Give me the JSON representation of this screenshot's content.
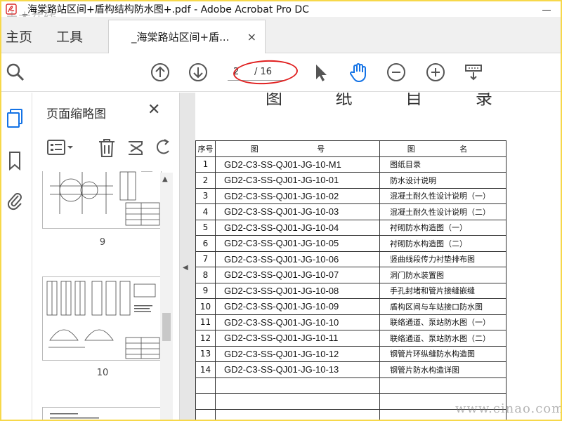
{
  "window": {
    "title": "_海棠路站区间+盾构结构防水图+.pdf - Adobe Acrobat Pro DC"
  },
  "tabs": {
    "home": "主页",
    "tools": "工具",
    "document": "_海棠路站区间+盾...",
    "close_glyph": "×"
  },
  "toolbar": {
    "icons": [
      "zoom-search-icon",
      "page-up-icon",
      "page-down-icon",
      "select-arrow-icon",
      "hand-tool-icon",
      "zoom-out-icon",
      "zoom-in-icon",
      "scroll-mode-icon"
    ],
    "page_current": "2",
    "page_total": "/ 16",
    "hand_color": "#1473e6"
  },
  "sidebar": {
    "icons": [
      "page-thumbnails-icon",
      "bookmark-icon",
      "attachment-icon"
    ],
    "active_color": "#1473e6"
  },
  "thumb_panel": {
    "title": "页面缩略图",
    "close_glyph": "✕",
    "tools": [
      "options-icon",
      "delete-icon",
      "crop-icon",
      "rotate-icon"
    ],
    "pages": [
      {
        "label": "9"
      },
      {
        "label": "10"
      }
    ]
  },
  "document": {
    "heading": "图 纸 目 录",
    "table": {
      "headers": [
        "序号",
        "图 号",
        "图 名"
      ],
      "rows": [
        [
          "1",
          "GD2-C3-SS-QJ01-JG-10-M1",
          "图纸目录"
        ],
        [
          "2",
          "GD2-C3-SS-QJ01-JG-10-01",
          "防水设计说明"
        ],
        [
          "3",
          "GD2-C3-SS-QJ01-JG-10-02",
          "混凝土耐久性设计说明（一）"
        ],
        [
          "4",
          "GD2-C3-SS-QJ01-JG-10-03",
          "混凝土耐久性设计说明（二）"
        ],
        [
          "5",
          "GD2-C3-SS-QJ01-JG-10-04",
          "衬砌防水构造图（一）"
        ],
        [
          "6",
          "GD2-C3-SS-QJ01-JG-10-05",
          "衬砌防水构造图（二）"
        ],
        [
          "7",
          "GD2-C3-SS-QJ01-JG-10-06",
          "竖曲线段传力衬垫排布图"
        ],
        [
          "8",
          "GD2-C3-SS-QJ01-JG-10-07",
          "洞门防水装置图"
        ],
        [
          "9",
          "GD2-C3-SS-QJ01-JG-10-08",
          "手孔封堵和管片接缝嵌缝"
        ],
        [
          "10",
          "GD2-C3-SS-QJ01-JG-10-09",
          "盾构区间与车站接口防水图"
        ],
        [
          "11",
          "GD2-C3-SS-QJ01-JG-10-10",
          "联络通道、泵站防水图（一）"
        ],
        [
          "12",
          "GD2-C3-SS-QJ01-JG-10-11",
          "联络通道、泵站防水图（二）"
        ],
        [
          "13",
          "GD2-C3-SS-QJ01-JG-10-12",
          "钢管片环纵缝防水构造图"
        ],
        [
          "14",
          "GD2-C3-SS-QJ01-JG-10-13",
          "钢管片防水构造详图"
        ],
        [
          "",
          "",
          ""
        ],
        [
          "",
          "",
          ""
        ],
        [
          "",
          "",
          ""
        ]
      ]
    }
  },
  "watermarks": {
    "top_left": "土木在线",
    "bottom_right": "www.cinao.com"
  },
  "colors": {
    "frame": "#f7d84a",
    "annotation": "#e02020",
    "accent": "#1473e6"
  }
}
